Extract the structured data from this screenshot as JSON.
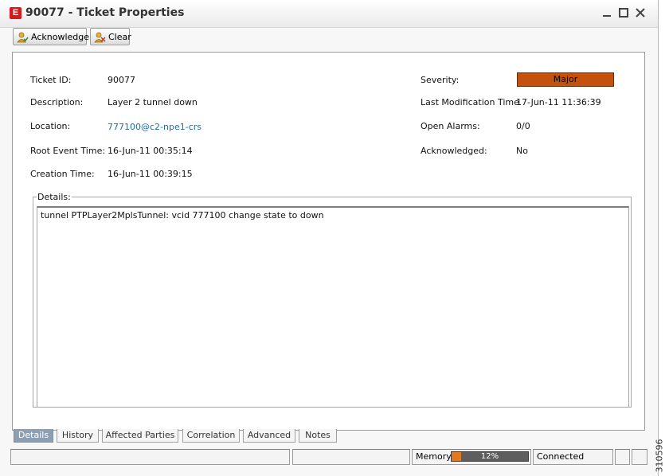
{
  "window": {
    "app_icon_letter": "E",
    "title": "90077 - Ticket Properties"
  },
  "toolbar": {
    "acknowledge_label": "Acknowledge",
    "clear_label": "Clear"
  },
  "fields_left": [
    {
      "label": "Ticket ID:",
      "value": "90077"
    },
    {
      "label": "Description:",
      "value": "Layer 2 tunnel down"
    },
    {
      "label": "Location:",
      "value": "777100@c2-npe1-crs"
    },
    {
      "label": "Root Event Time:",
      "value": "16-Jun-11 00:35:14"
    },
    {
      "label": "Creation Time:",
      "value": "16-Jun-11 00:39:15"
    }
  ],
  "fields_right": [
    {
      "label": "Severity:",
      "value": "Major"
    },
    {
      "label": "Last Modification Time",
      "value": "17-Jun-11 11:36:39"
    },
    {
      "label": "Open Alarms:",
      "value": "0/0"
    },
    {
      "label": "Acknowledged:",
      "value": "No"
    }
  ],
  "details": {
    "legend": "Details:",
    "text": "tunnel PTPLayer2MplsTunnel: vcid 777100 change state to down"
  },
  "tabs": [
    "Details",
    "History",
    "Affected Parties",
    "Correlation",
    "Advanced",
    "Notes"
  ],
  "active_tab": "Details",
  "statusbar": {
    "memory_label": "Memory:",
    "memory_percent_text": "12%",
    "memory_fraction": 0.12,
    "connection": "Connected"
  },
  "figure_code": "310596",
  "colors": {
    "severity_major": "#c4520e",
    "link": "#1e6ea0",
    "tab_active": "#8da0b3",
    "memory_fill": "#e07a22"
  }
}
